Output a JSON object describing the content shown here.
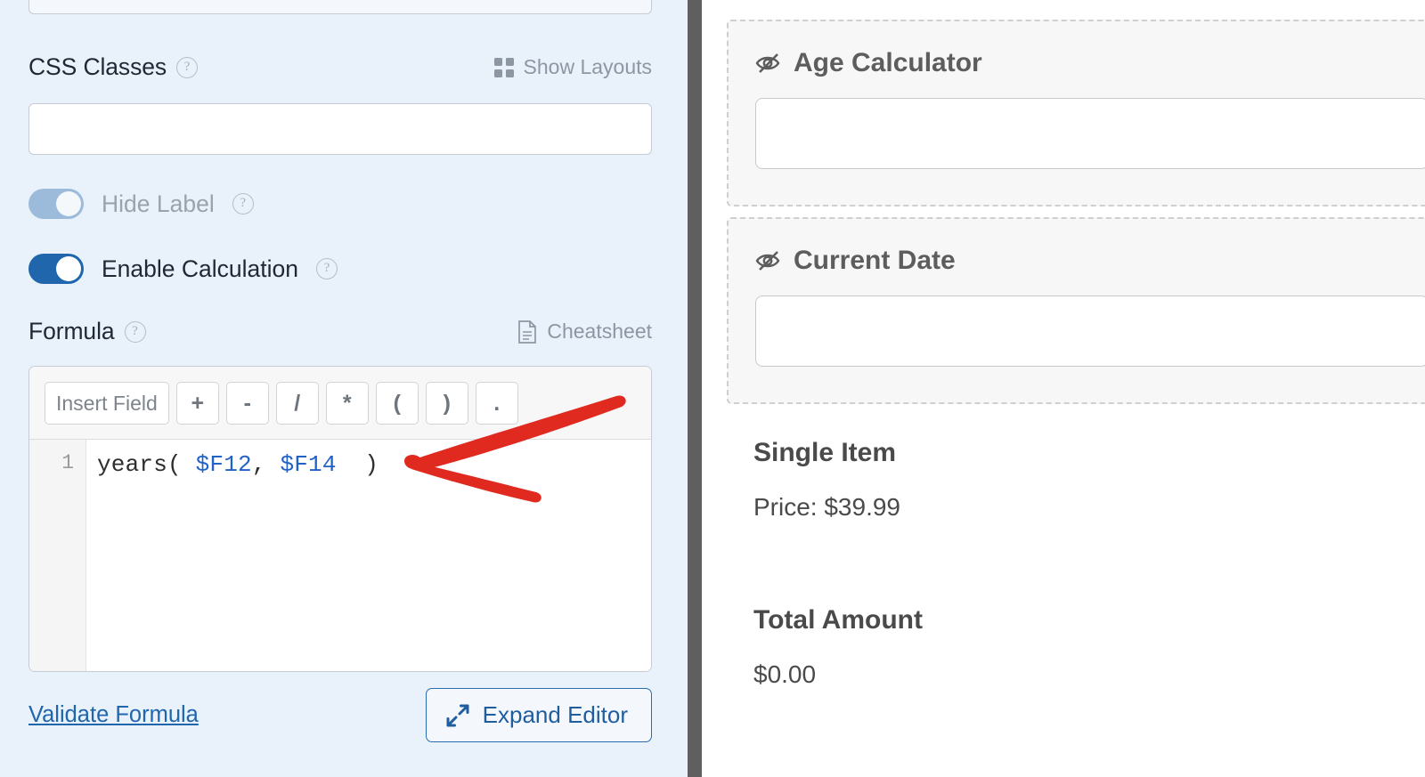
{
  "settings": {
    "css_classes": {
      "label": "CSS Classes",
      "help": "?",
      "show_layouts_label": "Show Layouts",
      "show_layouts_icon": "grid-icon",
      "value": "",
      "placeholder": ""
    },
    "hide_label": {
      "label": "Hide Label",
      "help": "?",
      "state": "on",
      "toggle_color": "#9cbbda"
    },
    "enable_calculation": {
      "label": "Enable Calculation",
      "help": "?",
      "state": "on",
      "toggle_color": "#1f66ad"
    },
    "formula": {
      "label": "Formula",
      "help": "?",
      "cheatsheet_label": "Cheatsheet",
      "cheatsheet_icon": "document-icon",
      "toolbar": [
        {
          "label": "Insert Field",
          "name": "insert-field-button",
          "wide": true
        },
        {
          "label": "+",
          "name": "plus-button",
          "wide": false
        },
        {
          "label": "-",
          "name": "minus-button",
          "wide": false
        },
        {
          "label": "/",
          "name": "divide-button",
          "wide": false
        },
        {
          "label": "*",
          "name": "multiply-button",
          "wide": false
        },
        {
          "label": "(",
          "name": "open-paren-button",
          "wide": false
        },
        {
          "label": ")",
          "name": "close-paren-button",
          "wide": false
        },
        {
          "label": ".",
          "name": "decimal-point-button",
          "wide": false
        }
      ],
      "line_number": "1",
      "code": {
        "fn": "years( ",
        "var1": "$F12",
        "sep": ", ",
        "var2": "$F14",
        "tail": "  )"
      },
      "code_full": "years( $F12, $F14  )",
      "var_color": "#2262c6"
    },
    "validate_formula_label": "Validate Formula",
    "expand_editor_label": "Expand Editor",
    "expand_editor_icon": "expand-arrows-icon",
    "accent_color": "#1f66ad"
  },
  "preview": {
    "fields": [
      {
        "title": "Age Calculator",
        "icon": "eye-slash-icon",
        "value": "",
        "placeholder": ""
      },
      {
        "title": "Current Date",
        "icon": "eye-slash-icon",
        "value": "",
        "placeholder": ""
      }
    ],
    "blocks": [
      {
        "title": "Single Item",
        "text": "Price: $39.99"
      },
      {
        "title": "Total Amount",
        "text": "$0.00"
      }
    ]
  },
  "annotation": {
    "type": "arrow",
    "color": "#e02a20",
    "points_to": "close-paren-in-formula"
  }
}
